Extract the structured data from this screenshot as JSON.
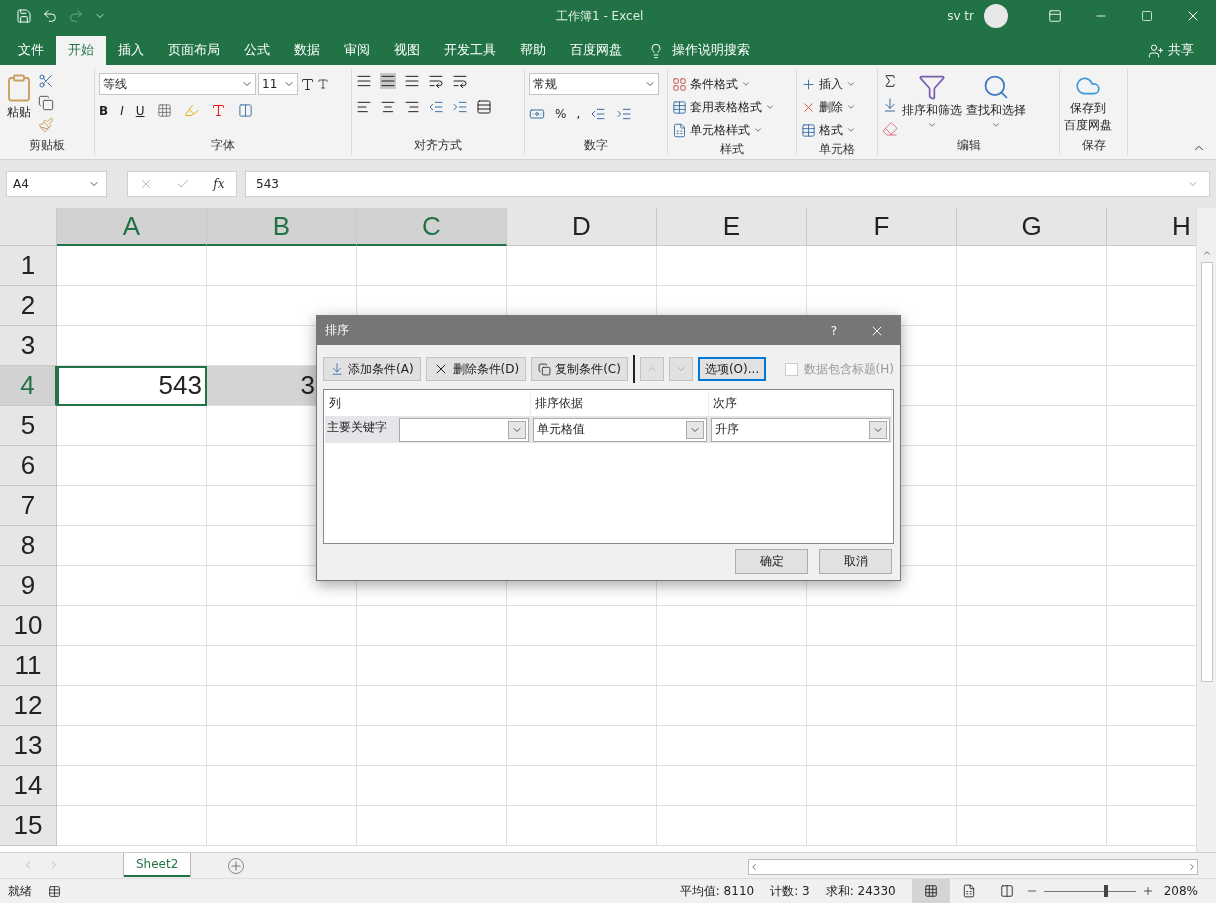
{
  "title_bar": {
    "title": "工作簿1  -  Excel",
    "user": "sv tr"
  },
  "ribbon_tabs": [
    {
      "label": "文件",
      "selected": false
    },
    {
      "label": "开始",
      "selected": true
    },
    {
      "label": "插入",
      "selected": false
    },
    {
      "label": "页面布局",
      "selected": false
    },
    {
      "label": "公式",
      "selected": false
    },
    {
      "label": "数据",
      "selected": false
    },
    {
      "label": "审阅",
      "selected": false
    },
    {
      "label": "视图",
      "selected": false
    },
    {
      "label": "开发工具",
      "selected": false
    },
    {
      "label": "帮助",
      "selected": false
    },
    {
      "label": "百度网盘",
      "selected": false
    }
  ],
  "tell_me": "操作说明搜索",
  "share": "共享",
  "ribbon": {
    "clipboard": {
      "paste": "粘贴",
      "label": "剪贴板"
    },
    "font": {
      "name": "等线",
      "size": "11",
      "bold": "B",
      "italic": "I",
      "underline": "U",
      "label": "字体"
    },
    "alignment": {
      "label": "对齐方式"
    },
    "number": {
      "format": "常规",
      "percent": "%",
      "comma": ",",
      "label": "数字"
    },
    "styles": {
      "items": [
        "条件格式",
        "套用表格格式",
        "单元格样式"
      ],
      "label": "样式"
    },
    "cells": {
      "items": [
        "插入",
        "删除",
        "格式"
      ],
      "label": "单元格"
    },
    "editing": {
      "items": [
        "排序和筛选",
        "查找和选择"
      ],
      "label": "编辑"
    },
    "save": {
      "items": [
        "保存到",
        "百度网盘"
      ],
      "label": "保存"
    }
  },
  "formula_bar": {
    "name_box": "A4",
    "function_label": "fx",
    "value": "543"
  },
  "grid": {
    "columns": [
      {
        "label": "A",
        "selected": true
      },
      {
        "label": "B",
        "selected": true
      },
      {
        "label": "C",
        "selected": true
      },
      {
        "label": "D",
        "selected": false
      },
      {
        "label": "E",
        "selected": false
      },
      {
        "label": "F",
        "selected": false
      },
      {
        "label": "G",
        "selected": false
      },
      {
        "label": "H",
        "selected": false
      }
    ],
    "rows": [
      {
        "header": "1",
        "selected": false,
        "cells": []
      },
      {
        "header": "2",
        "selected": false,
        "cells": []
      },
      {
        "header": "3",
        "selected": false,
        "cells": []
      },
      {
        "header": "4",
        "selected": true,
        "cells": [
          {
            "value": "543",
            "kind": "number",
            "active": true
          },
          {
            "value": "3",
            "kind": "partial",
            "active": false,
            "selected": true
          }
        ]
      },
      {
        "header": "5",
        "selected": false,
        "cells": []
      },
      {
        "header": "6",
        "selected": false,
        "cells": []
      },
      {
        "header": "7",
        "selected": false,
        "cells": []
      },
      {
        "header": "8",
        "selected": false,
        "cells": []
      },
      {
        "header": "9",
        "selected": false,
        "cells": []
      },
      {
        "header": "10",
        "selected": false,
        "cells": []
      },
      {
        "header": "11",
        "selected": false,
        "cells": []
      },
      {
        "header": "12",
        "selected": false,
        "cells": []
      },
      {
        "header": "13",
        "selected": false,
        "cells": []
      },
      {
        "header": "14",
        "selected": false,
        "cells": []
      },
      {
        "header": "15",
        "selected": false,
        "cells": []
      }
    ]
  },
  "dialog": {
    "title": "排序",
    "help": "?",
    "toolbar": [
      {
        "label": "添加条件(A)",
        "kind": "add"
      },
      {
        "label": "删除条件(D)",
        "kind": "delete"
      },
      {
        "label": "复制条件(C)",
        "kind": "copy"
      },
      {
        "label": "选项(O)...",
        "kind": "options"
      }
    ],
    "header_checkbox": {
      "label": "数据包含标题(H)",
      "checked": false,
      "disabled": true
    },
    "columns": [
      "列",
      "排序依据",
      "次序"
    ],
    "rows": [
      {
        "label": "主要关键字",
        "sort_on": "单元格值",
        "order": "升序"
      }
    ],
    "buttons": [
      "确定",
      "取消"
    ]
  },
  "sheet_tabs": [
    {
      "label": "Sheet2",
      "selected": true
    }
  ],
  "status_bar": {
    "ready": "就绪",
    "stats": [
      "平均值: 8110",
      "计数: 3",
      "求和: 24330"
    ],
    "zoom": "208%",
    "zoom_slider": {
      "level": 0.66
    }
  }
}
